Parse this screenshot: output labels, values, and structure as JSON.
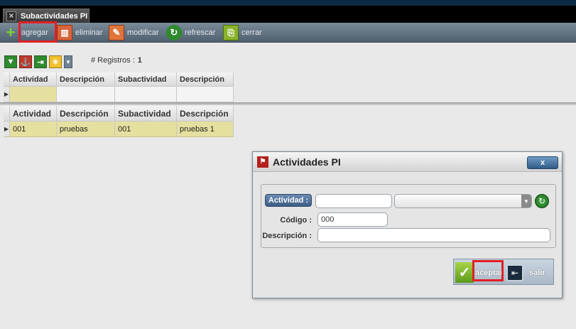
{
  "window": {
    "tab_title": "Subactividades PI"
  },
  "toolbar": {
    "add_label": "agregar",
    "delete_label": "eliminar",
    "edit_label": "modificar",
    "refresh_label": "refrescar",
    "close_label": "cerrar"
  },
  "records": {
    "label": "# Registros :",
    "count": "1"
  },
  "grid_top": {
    "headers": [
      "Actividad",
      "Descripción",
      "Subactividad",
      "Descripción"
    ]
  },
  "grid_bottom": {
    "headers": [
      "Actividad",
      "Descripción",
      "Subactividad",
      "Descripción"
    ],
    "rows": [
      {
        "actividad": "001",
        "descripcion": "pruebas",
        "subactividad": "001",
        "descripcion2": "pruebas 1"
      }
    ]
  },
  "modal": {
    "title": "Actividades PI",
    "close_label": "x",
    "actividad_label": "Actividad :",
    "actividad_value": "",
    "codigo_label": "Código :",
    "codigo_value": "000",
    "descripcion_label": "Descripción :",
    "descripcion_value": "",
    "accept_label": "aceptar",
    "exit_label": "salir"
  },
  "colors": {
    "highlight": "#e21f26",
    "toolbar": "#5f7080",
    "selected_row": "#e6e0a0"
  }
}
